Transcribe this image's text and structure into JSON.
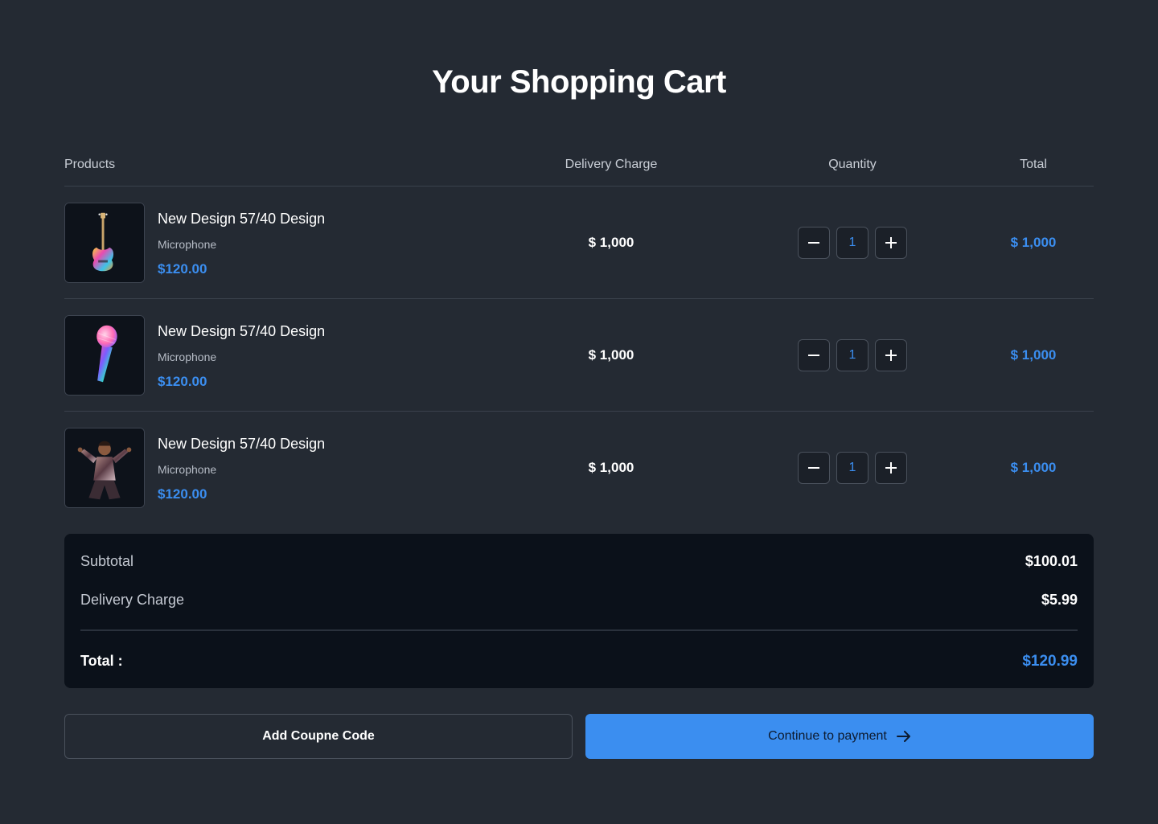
{
  "page": {
    "title": "Your Shopping Cart"
  },
  "table": {
    "headers": {
      "products": "Products",
      "delivery": "Delivery Charge",
      "quantity": "Quantity",
      "total": "Total"
    },
    "rows": [
      {
        "name": "New Design 57/40 Design",
        "category": "Microphone",
        "price": "$120.00",
        "delivery": "$ 1,000",
        "quantity": "1",
        "total": "$ 1,000",
        "image_icon": "guitar-icon"
      },
      {
        "name": "New Design 57/40 Design",
        "category": "Microphone",
        "price": "$120.00",
        "delivery": "$ 1,000",
        "quantity": "1",
        "total": "$ 1,000",
        "image_icon": "microphone-icon"
      },
      {
        "name": "New Design 57/40 Design",
        "category": "Microphone",
        "price": "$120.00",
        "delivery": "$ 1,000",
        "quantity": "1",
        "total": "$ 1,000",
        "image_icon": "singer-icon"
      }
    ]
  },
  "summary": {
    "subtotal_label": "Subtotal",
    "subtotal_value": "$100.01",
    "delivery_label": "Delivery Charge",
    "delivery_value": "$5.99",
    "total_label": "Total :",
    "total_value": "$120.99"
  },
  "actions": {
    "coupon_label": "Add Coupne Code",
    "pay_label": "Continue to payment"
  },
  "colors": {
    "background": "#242a33",
    "accent": "#3b8ef0",
    "panel": "#0b111a"
  }
}
